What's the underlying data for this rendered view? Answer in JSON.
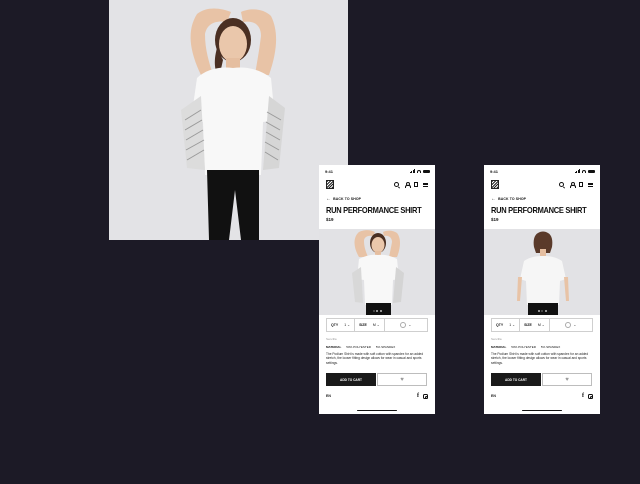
{
  "colors": {
    "background": "#1c1a26",
    "photo_bg": "#e2e2e5",
    "button_dark": "#1a1a1a"
  },
  "phones": [
    {
      "id": "front",
      "status_time": "9:41",
      "back_label": "BACK TO SHOP",
      "product_title": "RUN PERFORMANCE SHIRT",
      "price": "$19",
      "options": {
        "qty_label": "QTY",
        "qty_value": "1",
        "size_label": "SIZE",
        "size_value": "M"
      },
      "subtitle": "Sencilla",
      "material": {
        "label": "MATERIAL",
        "item1": "50% POLYESTER",
        "item2": "5% SPANDEX"
      },
      "description": "The Podium Shirt is made with soft cotton with spandex for an added stretch, the looser fitting design allows for wear in casual and sports settings.",
      "add_to_cart": "ADD TO CART",
      "language": "EN",
      "carousel_dots": 3,
      "active_dot": 1
    },
    {
      "id": "back",
      "status_time": "9:41",
      "back_label": "BACK TO SHOP",
      "product_title": "RUN PERFORMANCE SHIRT",
      "price": "$19",
      "options": {
        "qty_label": "QTY",
        "qty_value": "1",
        "size_label": "SIZE",
        "size_value": "M"
      },
      "subtitle": "Sencilla",
      "material": {
        "label": "MATERIAL",
        "item1": "50% POLYESTER",
        "item2": "5% SPANDEX"
      },
      "description": "The Podium Shirt is made with soft cotton with spandex for an added stretch, the looser fitting design allows for wear in casual and sports settings.",
      "add_to_cart": "ADD TO CART",
      "language": "EN",
      "carousel_dots": 3,
      "active_dot": 2
    }
  ]
}
